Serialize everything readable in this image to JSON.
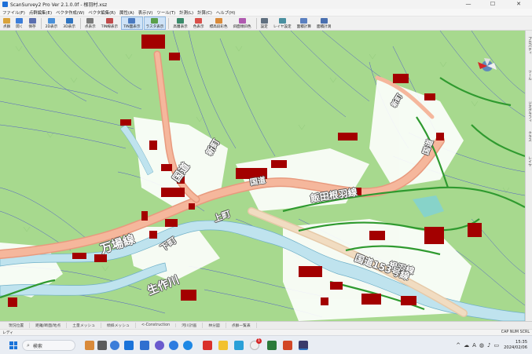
{
  "window": {
    "title": "ScanSurvey2 Pro  Ver 2.1.0.0f - 根羽村.xsz",
    "controls": {
      "minimize": "—",
      "maximize": "☐",
      "close": "✕"
    }
  },
  "menu": [
    "ファイル(F)",
    "点群編集(E)",
    "ベクタ作成(W)",
    "ベクタ編集(R)",
    "属性(A)",
    "表示(V)",
    "ツール(T)",
    "計測(L)",
    "計算(C)",
    "ヘルプ(H)"
  ],
  "toolbar": [
    {
      "label": "点群",
      "icon": "folder-icon",
      "color": "#d9a33b",
      "active": false
    },
    {
      "label": "開く",
      "icon": "open-icon",
      "color": "#3b7dd9",
      "active": false
    },
    {
      "label": "保存",
      "icon": "save-icon",
      "color": "#5a6fb0",
      "active": false
    },
    {
      "label": "2D表示",
      "icon": "view-2d-icon",
      "color": "#4a90d9",
      "active": false
    },
    {
      "label": "3D表示",
      "icon": "view-3d-icon",
      "color": "#2f74c0",
      "active": false
    },
    {
      "label": "点表示",
      "icon": "point-icon",
      "color": "#7a7a7a",
      "active": false
    },
    {
      "label": "TIN線表示",
      "icon": "tin-line-icon",
      "color": "#c04a4a",
      "active": false
    },
    {
      "label": "TIN面表示",
      "icon": "tin-face-icon",
      "color": "#4a7ac0",
      "active": true
    },
    {
      "label": "ラスタ表示",
      "icon": "raster-icon",
      "color": "#5aa04a",
      "active": true
    },
    {
      "label": "高層表示",
      "icon": "building-icon",
      "color": "#3a8a6a",
      "active": false
    },
    {
      "label": "色表示",
      "icon": "color-icon",
      "color": "#d9504a",
      "active": false
    },
    {
      "label": "標高段彩色",
      "icon": "elevation-icon",
      "color": "#d98a3a",
      "active": false
    },
    {
      "label": "斜面傾斜色",
      "icon": "slope-icon",
      "color": "#b05ab0",
      "active": false
    },
    {
      "label": "設定",
      "icon": "gear-icon",
      "color": "#607080",
      "active": false
    },
    {
      "label": "レイヤ設定",
      "icon": "layer-icon",
      "color": "#4a90a0",
      "active": false
    },
    {
      "label": "面積計算",
      "icon": "area-icon",
      "color": "#5a80c0",
      "active": false
    },
    {
      "label": "面積計測",
      "icon": "measure-icon",
      "color": "#4a70b0",
      "active": false
    }
  ],
  "map_labels": [
    {
      "text": "万場線",
      "name": "label-manba-line"
    },
    {
      "text": "生作川",
      "name": "label-river-lower"
    },
    {
      "text": "国道",
      "name": "label-national-road"
    },
    {
      "text": "下町",
      "name": "label-shimomachi"
    },
    {
      "text": "上町",
      "name": "label-kamimachi"
    },
    {
      "text": "新町",
      "name": "label-shinmachi"
    },
    {
      "text": "国道",
      "name": "label-national-road-2"
    },
    {
      "text": "国道",
      "name": "label-national-road-3"
    },
    {
      "text": "飯田根羽線",
      "name": "label-iida-neba-line"
    },
    {
      "text": "根羽線",
      "name": "label-neba-line"
    },
    {
      "text": "国道153号線",
      "name": "label-route153"
    },
    {
      "text": "新町",
      "name": "label-shinmachi-north"
    }
  ],
  "right_panel": [
    "プロパティ",
    "ツール",
    "ジオグラフィ",
    "クラス",
    "レイヤ"
  ],
  "bottom_tabs": [
    "現況位置",
    "距離/断面/地点",
    "土量メッシュ",
    "傾斜メッシュ",
    "<-Construction",
    "河川計画",
    "林分図",
    "点群一覧表"
  ],
  "status": {
    "left": "レディ",
    "right": "CAP NUM SCRL"
  },
  "taskbar": {
    "search_placeholder": "検索",
    "clock_time": "15:35",
    "clock_date": "2024/02/06",
    "tray_icons": [
      "^",
      "☁",
      "A",
      "◍",
      "♪",
      "▭"
    ],
    "notification_badge": "1"
  },
  "colors": {
    "map_green": "#a7d98e",
    "river": "#bfe3ee",
    "road": "#f5b79c",
    "contour": "#2b2bd6",
    "building": "#a30000",
    "boundary": "#2f9a2f",
    "active_button": "#cfe3f7"
  }
}
